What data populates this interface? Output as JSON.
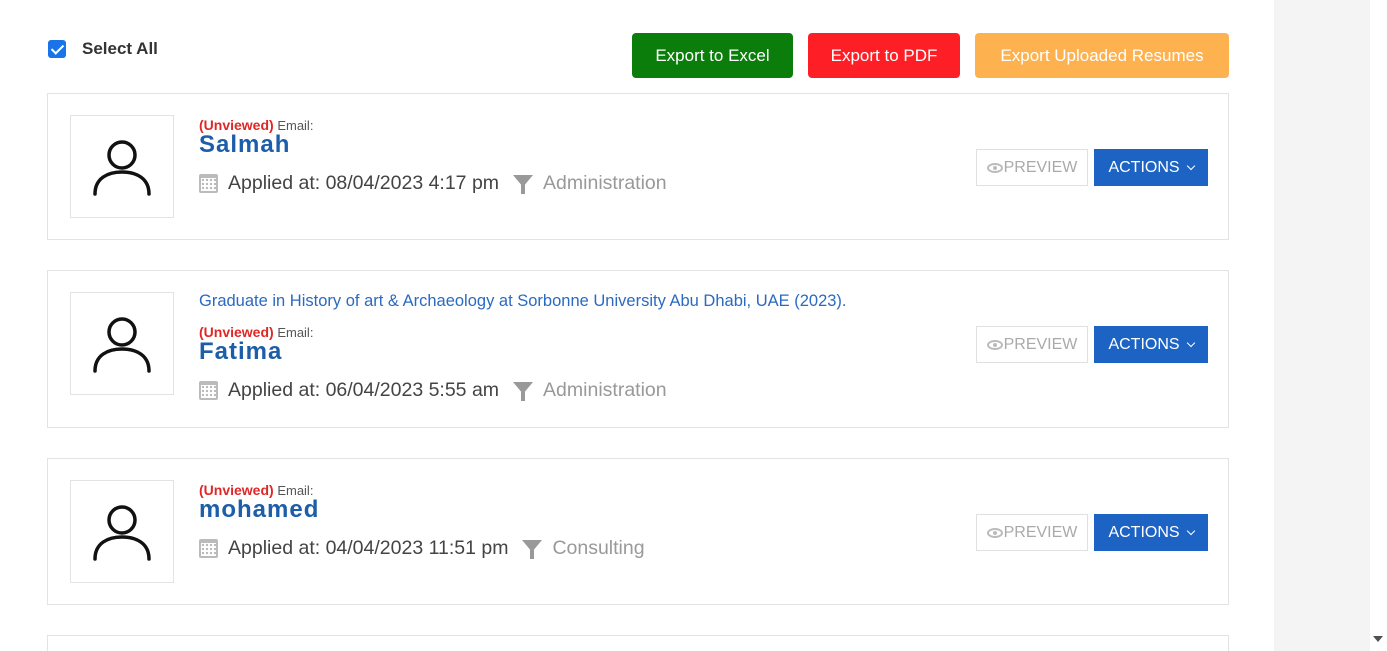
{
  "header": {
    "select_all_label": "Select All",
    "export_excel_label": "Export to Excel",
    "export_pdf_label": "Export to PDF",
    "export_resumes_label": "Export Uploaded Resumes",
    "colors": {
      "excel": "#0a7d0a",
      "pdf": "#fd1f25",
      "resumes": "#fdb14f"
    }
  },
  "applicants": [
    {
      "status": "(Unviewed)",
      "email_label": "Email:",
      "name": "Salmah",
      "applied": "Applied at: 08/04/2023 4:17 pm",
      "department": "Administration",
      "preview_label": "PREVIEW",
      "actions_label": "ACTIONS",
      "checked": true
    },
    {
      "education": "Graduate in History of art & Archaeology at Sorbonne University Abu Dhabi, UAE (2023).",
      "status": "(Unviewed)",
      "email_label": "Email:",
      "name": "Fatima",
      "applied": "Applied at: 06/04/2023 5:55 am",
      "department": "Administration",
      "preview_label": "PREVIEW",
      "actions_label": "ACTIONS",
      "checked": true
    },
    {
      "status": "(Unviewed)",
      "email_label": "Email:",
      "name": "mohamed",
      "applied": "Applied at: 04/04/2023 11:51 pm",
      "department": "Consulting",
      "preview_label": "PREVIEW",
      "actions_label": "ACTIONS",
      "checked": true
    }
  ]
}
